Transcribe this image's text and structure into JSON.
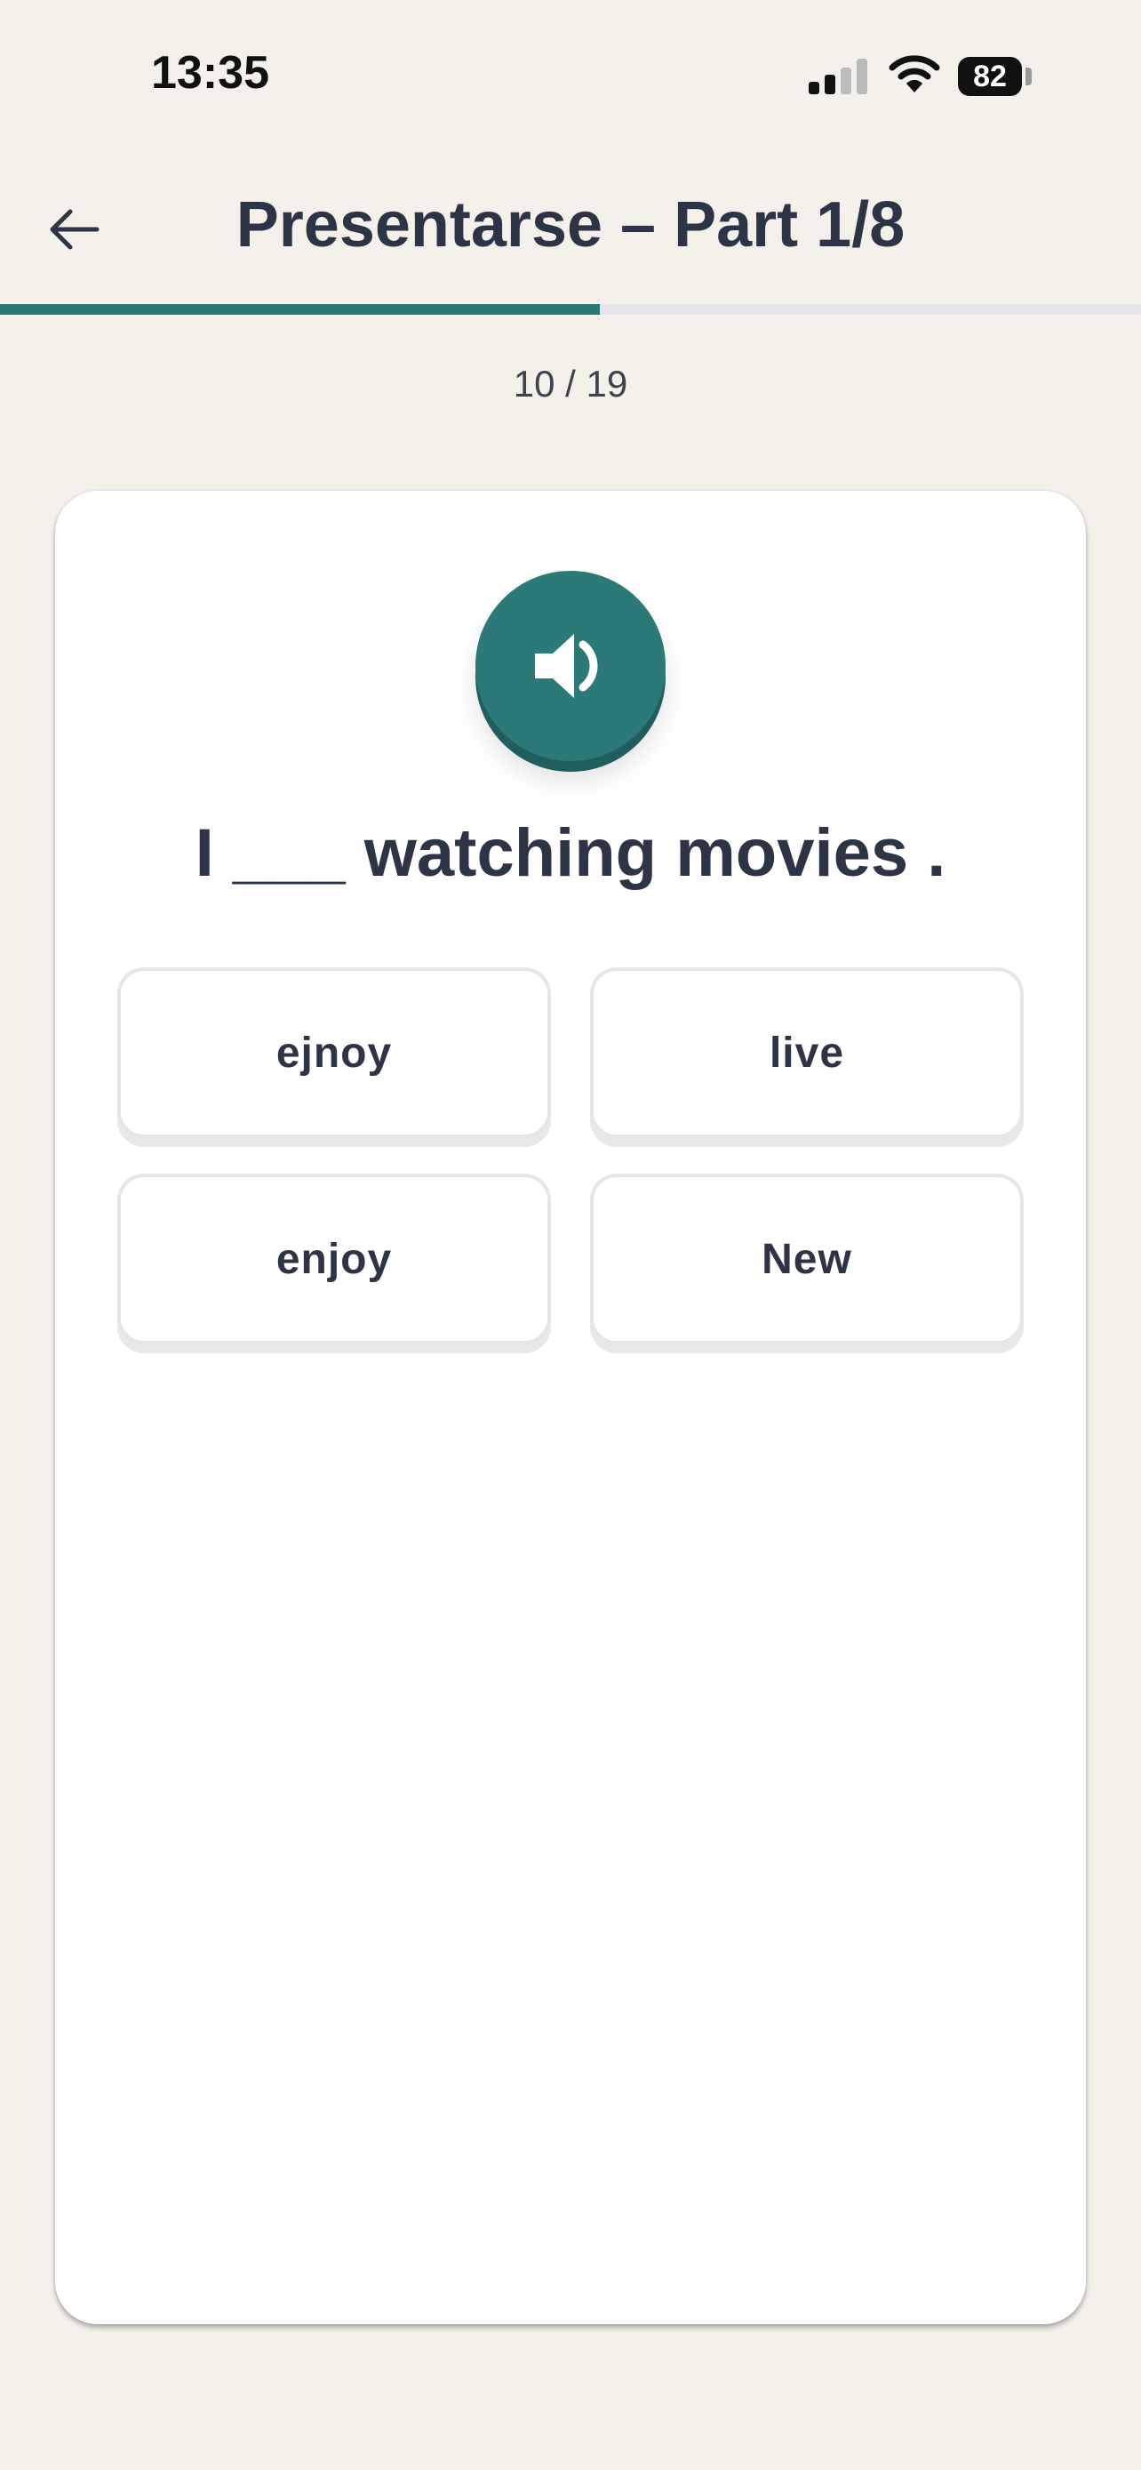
{
  "status_bar": {
    "time": "13:35",
    "battery": "82"
  },
  "header": {
    "title": "Presentarse – Part 1/8"
  },
  "progress": {
    "current": 10,
    "total": 19,
    "label": "10 / 19",
    "fill_fraction": 0.526
  },
  "exercise": {
    "sentence": "I ___ watching movies .",
    "options": [
      "ejnoy",
      "live",
      "enjoy",
      "New"
    ]
  },
  "colors": {
    "accent": "#2b7a78",
    "background": "#f4f1eb",
    "text": "#2d3446"
  }
}
